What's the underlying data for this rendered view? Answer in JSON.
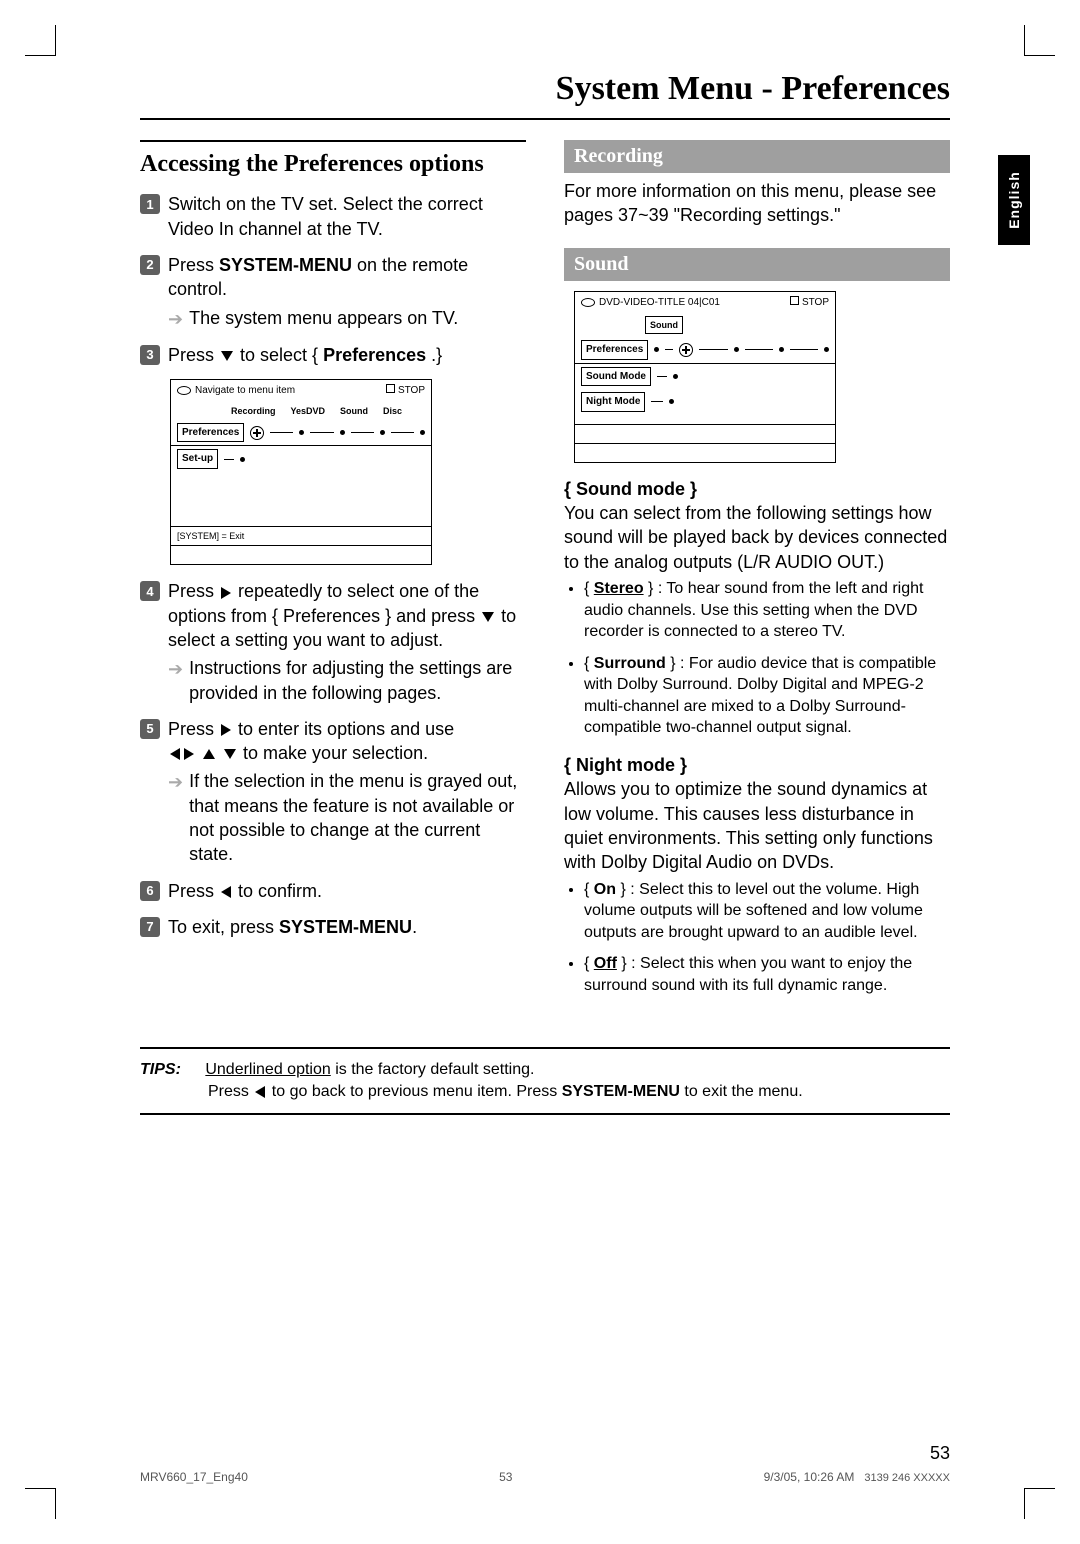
{
  "title": "System Menu - Preferences",
  "language_tab": "English",
  "left": {
    "heading": "Accessing the Preferences options",
    "step1": "Switch on the TV set.  Select the correct  Video In channel at the TV.",
    "step2_a": "Press ",
    "step2_b": "SYSTEM-MENU",
    "step2_c": " on the remote control.",
    "step2_sub": "The system menu appears on TV.",
    "step3_a": "Press ",
    "step3_b": " to select { ",
    "step3_c": "Preferences",
    "step3_d": " .}",
    "osd1": {
      "top_label": "Navigate to menu item",
      "stop": "STOP",
      "menu_tabs": [
        "Recording",
        "YesDVD",
        "Sound",
        "Disc"
      ],
      "row1": "Preferences",
      "row2": "Set-up",
      "footer": "[SYSTEM] = Exit"
    },
    "step4_a": "Press ",
    "step4_b": " repeatedly to select one of the options from { Preferences } and press ",
    "step4_c": " to select a setting you want to adjust.",
    "step4_sub": "Instructions for adjusting the settings are provided in the following pages.",
    "step5_a": "Press ",
    "step5_b": " to enter its options and use ",
    "step5_c": " to make your selection.",
    "step5_sub": "If the selection in the menu is grayed out, that means the feature is not available or not possible to change at the current state.",
    "step6_a": "Press ",
    "step6_b": " to confirm.",
    "step7_a": "To exit, press ",
    "step7_b": "SYSTEM-MENU",
    "step7_c": "."
  },
  "right": {
    "rec_head": "Recording",
    "rec_body": "For more information on this menu, please see pages 37~39 \"Recording settings.\"",
    "sound_head": "Sound",
    "osd2": {
      "top_label": "DVD-VIDEO-TITLE 04|C01",
      "stop": "STOP",
      "menu_tab": "Sound",
      "row1": "Preferences",
      "row2": "Sound Mode",
      "row3": "Night Mode"
    },
    "sound_mode_head": "{ Sound mode }",
    "sound_mode_body": "You can select from the following settings how sound will be played back by devices connected to the analog outputs (L/R AUDIO OUT.)",
    "sm_opt1_label": "Stereo",
    "sm_opt1_rest": " } : To hear sound from the left and right audio channels. Use this setting when the DVD recorder is connected to a stereo TV.",
    "sm_opt2_label": "Surround",
    "sm_opt2_rest": " } : For audio device that is compatible with Dolby Surround.  Dolby Digital and MPEG-2 multi-channel are mixed to a Dolby Surround-compatible two-channel output signal.",
    "night_head": "{ Night mode }",
    "night_body": "Allows you to optimize the sound dynamics at low volume.  This causes less disturbance in quiet environments.  This setting only functions with Dolby Digital Audio on DVDs.",
    "nm_opt1_label": "On",
    "nm_opt1_rest": " } : Select this to level out the volume. High volume outputs will be softened and low volume outputs are brought upward to an audible level.",
    "nm_opt2_label": "Off",
    "nm_opt2_rest": " } : Select this when you want to enjoy the surround sound with its full dynamic range."
  },
  "tips": {
    "label": "TIPS:",
    "line1_u": "Underlined option",
    "line1_rest": " is the factory default setting.",
    "line2_a": "Press ",
    "line2_b": " to go back to previous menu item.  Press ",
    "line2_c": "SYSTEM-MENU",
    "line2_d": " to exit the menu."
  },
  "page_number": "53",
  "footer": {
    "left": "MRV660_17_Eng40",
    "center": "53",
    "right": "9/3/05, 10:26 AM",
    "code": "3139 246 XXXXX"
  }
}
